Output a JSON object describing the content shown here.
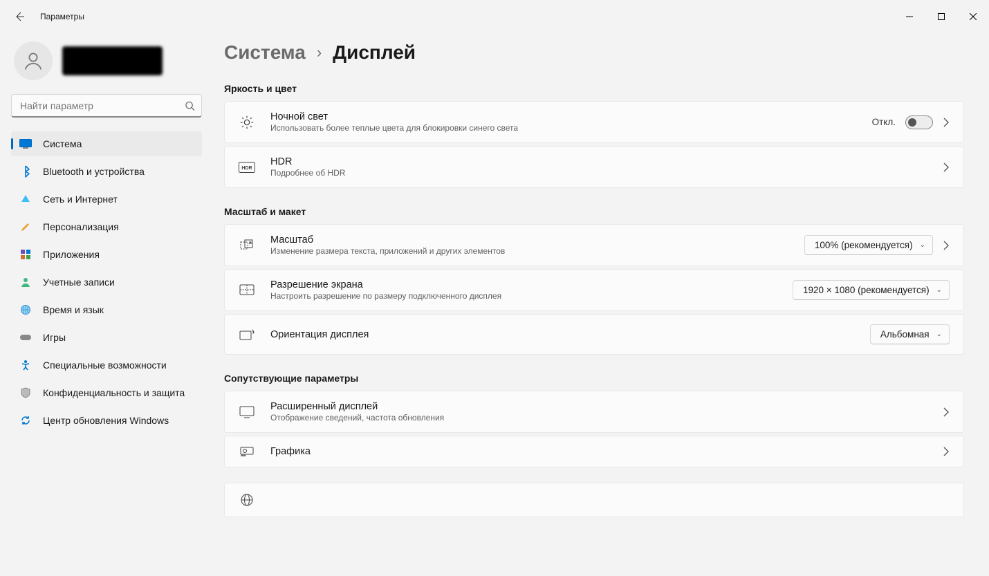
{
  "window": {
    "title": "Параметры"
  },
  "search": {
    "placeholder": "Найти параметр"
  },
  "nav": {
    "items": [
      {
        "label": "Система"
      },
      {
        "label": "Bluetooth и устройства"
      },
      {
        "label": "Сеть и Интернет"
      },
      {
        "label": "Персонализация"
      },
      {
        "label": "Приложения"
      },
      {
        "label": "Учетные записи"
      },
      {
        "label": "Время и язык"
      },
      {
        "label": "Игры"
      },
      {
        "label": "Специальные возможности"
      },
      {
        "label": "Конфиденциальность и защита"
      },
      {
        "label": "Центр обновления Windows"
      }
    ]
  },
  "breadcrumb": {
    "parent": "Система",
    "current": "Дисплей"
  },
  "sections": {
    "brightness": {
      "title": "Яркость и цвет",
      "night_light": {
        "title": "Ночной свет",
        "desc": "Использовать более теплые цвета для блокировки синего света",
        "toggle_label": "Откл."
      },
      "hdr": {
        "title": "HDR",
        "desc": "Подробнее об HDR"
      }
    },
    "scale": {
      "title": "Масштаб и макет",
      "scale_item": {
        "title": "Масштаб",
        "desc": "Изменение размера текста, приложений и других элементов",
        "value": "100% (рекомендуется)"
      },
      "resolution": {
        "title": "Разрешение экрана",
        "desc": "Настроить разрешение по размеру подключенного дисплея",
        "value": "1920 × 1080 (рекомендуется)"
      },
      "orientation": {
        "title": "Ориентация дисплея",
        "value": "Альбомная"
      }
    },
    "related": {
      "title": "Сопутствующие параметры",
      "advanced": {
        "title": "Расширенный дисплей",
        "desc": "Отображение сведений, частота обновления"
      },
      "graphics": {
        "title": "Графика"
      }
    }
  }
}
